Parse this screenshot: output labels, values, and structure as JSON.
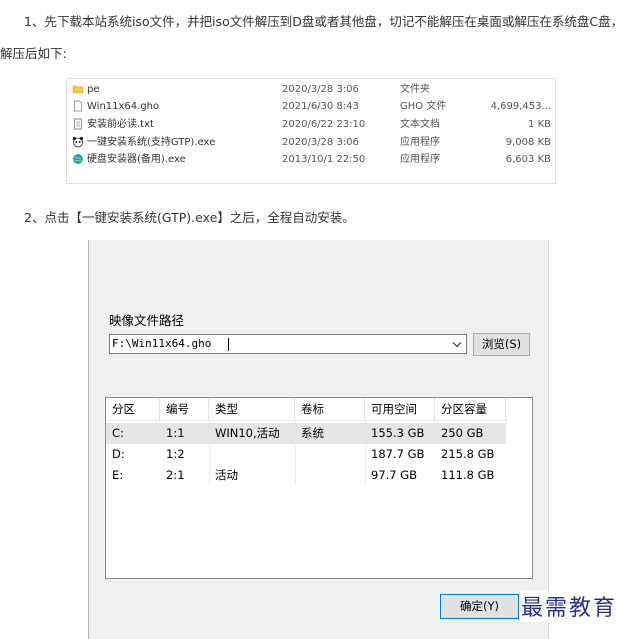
{
  "step1": {
    "line1": "1、先下载本站系统iso文件，并把iso文件解压到D盘或者其他盘，切记不能解压在桌面或解压在系统盘C盘，",
    "line2": "解压后如下:"
  },
  "files": [
    {
      "name": "pe",
      "date": "2020/3/28 3:06",
      "type": "文件夹",
      "size": "",
      "icon": "folder-icon"
    },
    {
      "name": "Win11x64.gho",
      "date": "2021/6/30 8:43",
      "type": "GHO 文件",
      "size": "4,699,453...",
      "icon": "file-icon"
    },
    {
      "name": "安装前必读.txt",
      "date": "2020/6/22 23:10",
      "type": "文本文档",
      "size": "1 KB",
      "icon": "text-file-icon"
    },
    {
      "name": "一键安装系统(支持GTP).exe",
      "date": "2020/3/28 3:06",
      "type": "应用程序",
      "size": "9,008 KB",
      "icon": "panda-app-icon"
    },
    {
      "name": "硬盘安装器(备用).exe",
      "date": "2013/10/1 22:50",
      "type": "应用程序",
      "size": "6,603 KB",
      "icon": "globe-app-icon"
    }
  ],
  "step2": {
    "text": "2、点击【一键安装系统(GTP).exe】之后，全程自动安装。"
  },
  "dialog": {
    "image_path_label": "映像文件路径",
    "image_path_value": "F:\\Win11x64.gho",
    "browse_label": "浏览(S)",
    "ok_label": "确定(Y)",
    "columns": [
      "分区",
      "编号",
      "类型",
      "卷标",
      "可用空间",
      "分区容量"
    ],
    "partitions": [
      {
        "drive": "C:",
        "num": "1:1",
        "type": "WIN10,活动",
        "label": "系统",
        "free": "155.3 GB",
        "capacity": "250 GB",
        "selected": true
      },
      {
        "drive": "D:",
        "num": "1:2",
        "type": "",
        "label": "",
        "free": "187.7 GB",
        "capacity": "215.8 GB",
        "selected": false
      },
      {
        "drive": "E:",
        "num": "2:1",
        "type": "活动",
        "label": "",
        "free": "97.7 GB",
        "capacity": "111.8 GB",
        "selected": false
      }
    ]
  },
  "watermark": "最需教育",
  "colors": {
    "selected_row": "#e5e5e5",
    "watermark": "#2b2f8c",
    "folder": "#f4c542"
  }
}
